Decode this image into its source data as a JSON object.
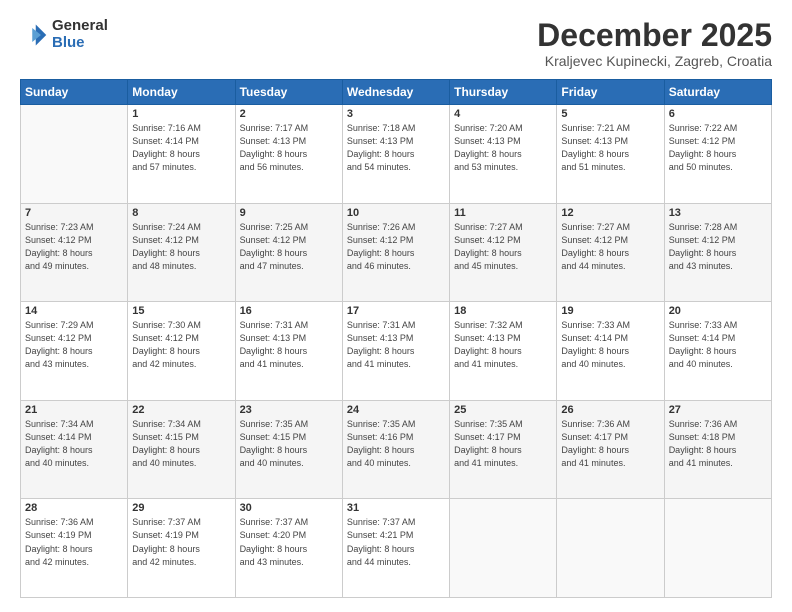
{
  "logo": {
    "general": "General",
    "blue": "Blue"
  },
  "header": {
    "month": "December 2025",
    "location": "Kraljevec Kupinecki, Zagreb, Croatia"
  },
  "weekdays": [
    "Sunday",
    "Monday",
    "Tuesday",
    "Wednesday",
    "Thursday",
    "Friday",
    "Saturday"
  ],
  "weeks": [
    [
      {
        "day": "",
        "sunrise": "",
        "sunset": "",
        "daylight": ""
      },
      {
        "day": "1",
        "sunrise": "Sunrise: 7:16 AM",
        "sunset": "Sunset: 4:14 PM",
        "daylight": "Daylight: 8 hours and 57 minutes."
      },
      {
        "day": "2",
        "sunrise": "Sunrise: 7:17 AM",
        "sunset": "Sunset: 4:13 PM",
        "daylight": "Daylight: 8 hours and 56 minutes."
      },
      {
        "day": "3",
        "sunrise": "Sunrise: 7:18 AM",
        "sunset": "Sunset: 4:13 PM",
        "daylight": "Daylight: 8 hours and 54 minutes."
      },
      {
        "day": "4",
        "sunrise": "Sunrise: 7:20 AM",
        "sunset": "Sunset: 4:13 PM",
        "daylight": "Daylight: 8 hours and 53 minutes."
      },
      {
        "day": "5",
        "sunrise": "Sunrise: 7:21 AM",
        "sunset": "Sunset: 4:13 PM",
        "daylight": "Daylight: 8 hours and 51 minutes."
      },
      {
        "day": "6",
        "sunrise": "Sunrise: 7:22 AM",
        "sunset": "Sunset: 4:12 PM",
        "daylight": "Daylight: 8 hours and 50 minutes."
      }
    ],
    [
      {
        "day": "7",
        "sunrise": "Sunrise: 7:23 AM",
        "sunset": "Sunset: 4:12 PM",
        "daylight": "Daylight: 8 hours and 49 minutes."
      },
      {
        "day": "8",
        "sunrise": "Sunrise: 7:24 AM",
        "sunset": "Sunset: 4:12 PM",
        "daylight": "Daylight: 8 hours and 48 minutes."
      },
      {
        "day": "9",
        "sunrise": "Sunrise: 7:25 AM",
        "sunset": "Sunset: 4:12 PM",
        "daylight": "Daylight: 8 hours and 47 minutes."
      },
      {
        "day": "10",
        "sunrise": "Sunrise: 7:26 AM",
        "sunset": "Sunset: 4:12 PM",
        "daylight": "Daylight: 8 hours and 46 minutes."
      },
      {
        "day": "11",
        "sunrise": "Sunrise: 7:27 AM",
        "sunset": "Sunset: 4:12 PM",
        "daylight": "Daylight: 8 hours and 45 minutes."
      },
      {
        "day": "12",
        "sunrise": "Sunrise: 7:27 AM",
        "sunset": "Sunset: 4:12 PM",
        "daylight": "Daylight: 8 hours and 44 minutes."
      },
      {
        "day": "13",
        "sunrise": "Sunrise: 7:28 AM",
        "sunset": "Sunset: 4:12 PM",
        "daylight": "Daylight: 8 hours and 43 minutes."
      }
    ],
    [
      {
        "day": "14",
        "sunrise": "Sunrise: 7:29 AM",
        "sunset": "Sunset: 4:12 PM",
        "daylight": "Daylight: 8 hours and 43 minutes."
      },
      {
        "day": "15",
        "sunrise": "Sunrise: 7:30 AM",
        "sunset": "Sunset: 4:12 PM",
        "daylight": "Daylight: 8 hours and 42 minutes."
      },
      {
        "day": "16",
        "sunrise": "Sunrise: 7:31 AM",
        "sunset": "Sunset: 4:13 PM",
        "daylight": "Daylight: 8 hours and 41 minutes."
      },
      {
        "day": "17",
        "sunrise": "Sunrise: 7:31 AM",
        "sunset": "Sunset: 4:13 PM",
        "daylight": "Daylight: 8 hours and 41 minutes."
      },
      {
        "day": "18",
        "sunrise": "Sunrise: 7:32 AM",
        "sunset": "Sunset: 4:13 PM",
        "daylight": "Daylight: 8 hours and 41 minutes."
      },
      {
        "day": "19",
        "sunrise": "Sunrise: 7:33 AM",
        "sunset": "Sunset: 4:14 PM",
        "daylight": "Daylight: 8 hours and 40 minutes."
      },
      {
        "day": "20",
        "sunrise": "Sunrise: 7:33 AM",
        "sunset": "Sunset: 4:14 PM",
        "daylight": "Daylight: 8 hours and 40 minutes."
      }
    ],
    [
      {
        "day": "21",
        "sunrise": "Sunrise: 7:34 AM",
        "sunset": "Sunset: 4:14 PM",
        "daylight": "Daylight: 8 hours and 40 minutes."
      },
      {
        "day": "22",
        "sunrise": "Sunrise: 7:34 AM",
        "sunset": "Sunset: 4:15 PM",
        "daylight": "Daylight: 8 hours and 40 minutes."
      },
      {
        "day": "23",
        "sunrise": "Sunrise: 7:35 AM",
        "sunset": "Sunset: 4:15 PM",
        "daylight": "Daylight: 8 hours and 40 minutes."
      },
      {
        "day": "24",
        "sunrise": "Sunrise: 7:35 AM",
        "sunset": "Sunset: 4:16 PM",
        "daylight": "Daylight: 8 hours and 40 minutes."
      },
      {
        "day": "25",
        "sunrise": "Sunrise: 7:35 AM",
        "sunset": "Sunset: 4:17 PM",
        "daylight": "Daylight: 8 hours and 41 minutes."
      },
      {
        "day": "26",
        "sunrise": "Sunrise: 7:36 AM",
        "sunset": "Sunset: 4:17 PM",
        "daylight": "Daylight: 8 hours and 41 minutes."
      },
      {
        "day": "27",
        "sunrise": "Sunrise: 7:36 AM",
        "sunset": "Sunset: 4:18 PM",
        "daylight": "Daylight: 8 hours and 41 minutes."
      }
    ],
    [
      {
        "day": "28",
        "sunrise": "Sunrise: 7:36 AM",
        "sunset": "Sunset: 4:19 PM",
        "daylight": "Daylight: 8 hours and 42 minutes."
      },
      {
        "day": "29",
        "sunrise": "Sunrise: 7:37 AM",
        "sunset": "Sunset: 4:19 PM",
        "daylight": "Daylight: 8 hours and 42 minutes."
      },
      {
        "day": "30",
        "sunrise": "Sunrise: 7:37 AM",
        "sunset": "Sunset: 4:20 PM",
        "daylight": "Daylight: 8 hours and 43 minutes."
      },
      {
        "day": "31",
        "sunrise": "Sunrise: 7:37 AM",
        "sunset": "Sunset: 4:21 PM",
        "daylight": "Daylight: 8 hours and 44 minutes."
      },
      {
        "day": "",
        "sunrise": "",
        "sunset": "",
        "daylight": ""
      },
      {
        "day": "",
        "sunrise": "",
        "sunset": "",
        "daylight": ""
      },
      {
        "day": "",
        "sunrise": "",
        "sunset": "",
        "daylight": ""
      }
    ]
  ]
}
